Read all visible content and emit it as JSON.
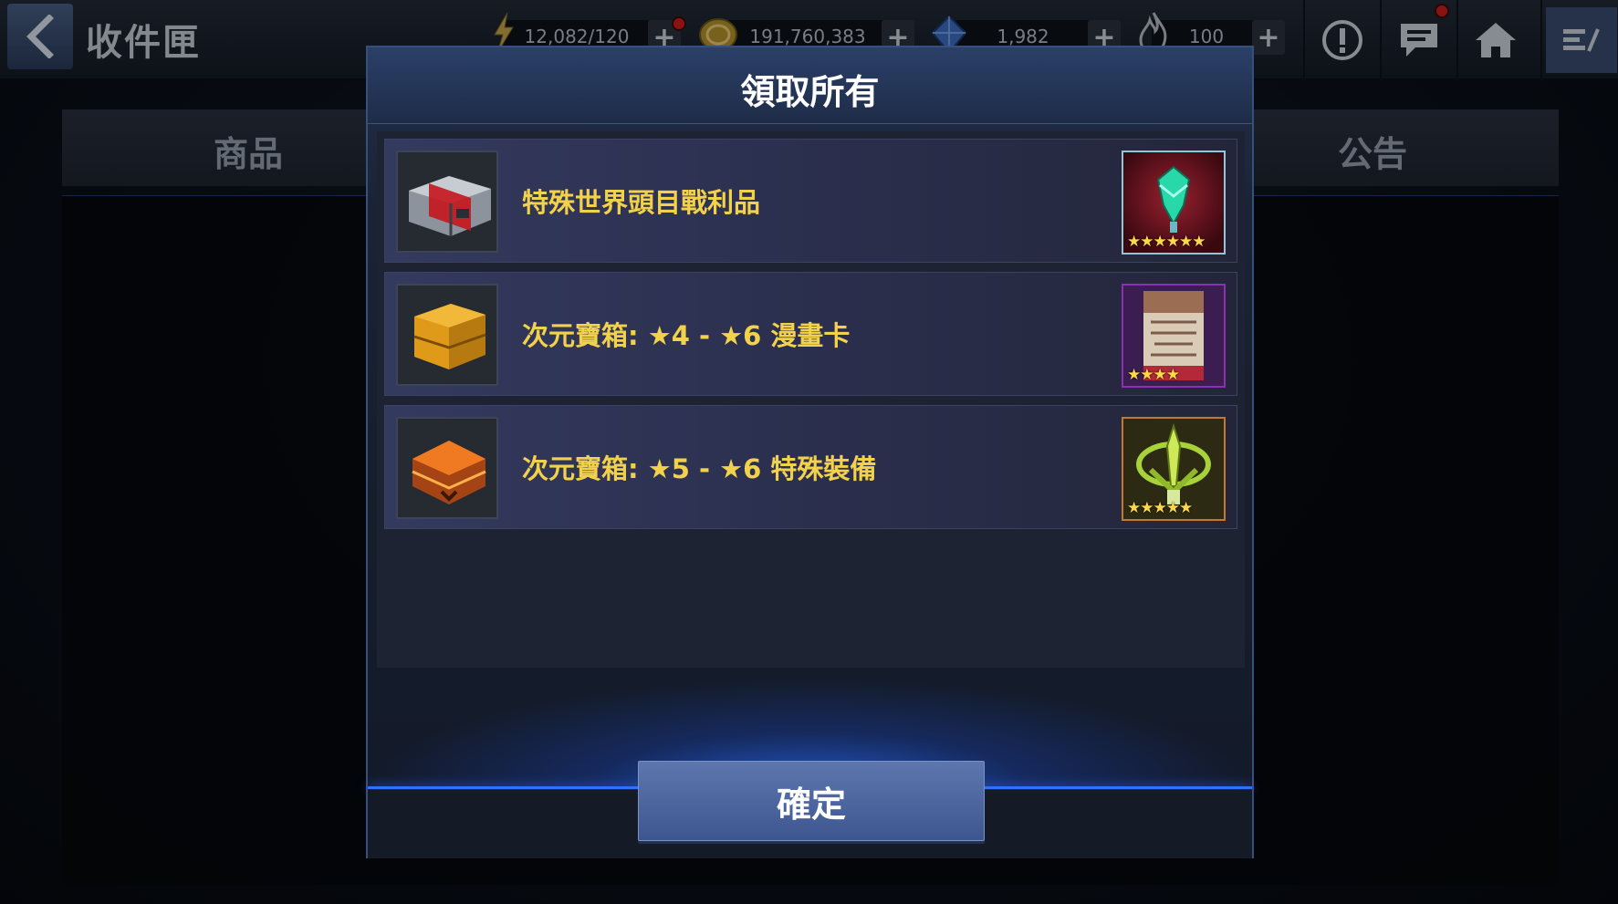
{
  "header": {
    "title": "收件匣",
    "resources": [
      {
        "name": "energy",
        "value": "12,082/120",
        "icon": "lightning-icon"
      },
      {
        "name": "gold",
        "value": "191,760,383",
        "icon": "gold-coin-icon"
      },
      {
        "name": "crystal",
        "value": "1,982",
        "icon": "crystal-icon"
      },
      {
        "name": "fire",
        "value": "100",
        "icon": "flame-icon"
      }
    ]
  },
  "tabs": {
    "left": "商品",
    "right": "公告"
  },
  "modal": {
    "title": "領取所有",
    "confirm_label": "確定",
    "items": [
      {
        "label": "特殊世界頭目戰利品",
        "stars": "★★★★★★",
        "box_icon": "red-chest-icon",
        "reward_icon": "green-emblem-icon"
      },
      {
        "label": "次元寶箱: ★4 - ★6 漫畫卡",
        "stars": "★★★★",
        "box_icon": "gold-chest-icon",
        "reward_icon": "comic-card-icon"
      },
      {
        "label": "次元寶箱: ★5 - ★6 特殊裝備",
        "stars": "★★★★★",
        "box_icon": "orange-chest-icon",
        "reward_icon": "gear-trophy-icon"
      }
    ]
  },
  "colors": {
    "accent_yellow": "#f3d24b",
    "modal_border": "#35507a",
    "button": "#4a64a0",
    "glow": "#2f72ff",
    "notification": "#d31e1e"
  }
}
